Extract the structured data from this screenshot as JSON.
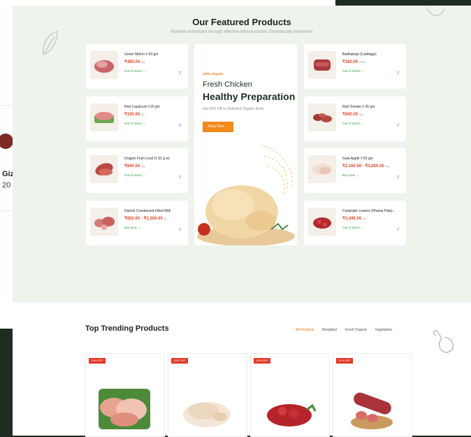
{
  "featured": {
    "title": "Our Featured Products",
    "subtitle": "Platform mindshare through effective infrastructures. Dramatically implement"
  },
  "background_card": {
    "name_fragment": "Giz",
    "price_fragment": "20"
  },
  "left_products": [
    {
      "name": "Green Melon ± 50 gm",
      "price": "₹480.00",
      "unit": "/kg",
      "stock": "Out of Stock →",
      "cart": "🛒"
    },
    {
      "name": "Red Capsicum ±15 gm",
      "price": "₹100.00",
      "unit": "/pc",
      "stock": "Out of Stock →",
      "cart": "🛒"
    },
    {
      "name": "Dragon Fruit Local (± 50 g w)",
      "price": "₹840.00",
      "unit": "/kg",
      "stock": "Out of Stock →",
      "cart": "🛒"
    },
    {
      "name": "Danish Condensed Filled Milk",
      "price": "₹850.00 - ₹2,200.00",
      "unit": "/ltr",
      "stock": "Buy Now →",
      "cart": "🛒"
    }
  ],
  "right_products": [
    {
      "name": "Badhakopi (Cabbage)",
      "price": "₹180.00",
      "unit": "/each",
      "stock": "Out of Stock →",
      "cart": "🛒"
    },
    {
      "name": "Red Tomato ± 25 gm",
      "price": "₹640.00",
      "unit": "/kg",
      "stock": "Out of Stock →",
      "cart": "🛒"
    },
    {
      "name": "Gala Apple ± 50 gm",
      "price": "₹2,160.00 - ₹3,000.00",
      "unit": "/kg",
      "stock": "Buy Now →",
      "cart": "🛒"
    },
    {
      "name": "Coriander Leaves (Dhania Pata)...",
      "price": "₹1,440.00",
      "unit": "/pc",
      "stock": "Out of Stock →",
      "cart": "🛒"
    }
  ],
  "promo": {
    "tag": "100% Organic",
    "headline1": "Fresh Chicken",
    "headline2": "Healthy Preparation",
    "description": "Get 50% Off on Selected Organic Items",
    "button": "Shop Now →"
  },
  "trending": {
    "title": "Top Trending Products",
    "filters": [
      "All Products",
      "Breakfast",
      "Fresh Organic",
      "Vegetables"
    ],
    "active_filter": "All Products",
    "cards": [
      {
        "badge": "10% OFF"
      },
      {
        "badge": "10% OFF"
      },
      {
        "badge": "10% OFF"
      },
      {
        "badge": "10% OFF"
      }
    ]
  },
  "colors": {
    "accent_orange": "#f08a1c",
    "price_red": "#e0492b",
    "stock_green": "#3a9a45",
    "section_bg": "#eef4ec"
  }
}
